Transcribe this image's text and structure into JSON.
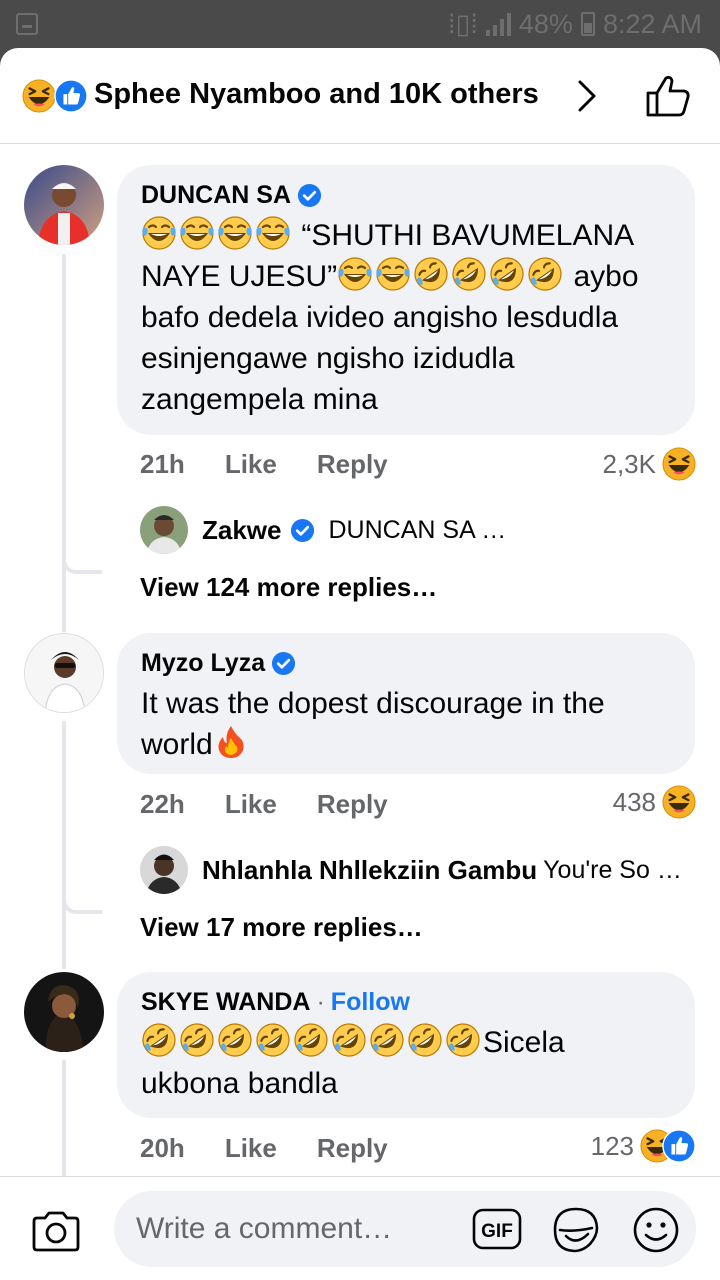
{
  "status_bar": {
    "battery": "48%",
    "time": "8:22 AM"
  },
  "header": {
    "reactors_text": "Sphee Nyamboo and 10K others"
  },
  "comments": [
    {
      "name": "DUNCAN SA",
      "text_prefix": "“SHUTHI BAVUMELANA NAYE UJESU”",
      "text_suffix": " aybo bafo dedela ivideo angisho lesdudla esinjengawe ngisho izidudla zangempela mina",
      "time": "21h",
      "like": "Like",
      "reply": "Reply",
      "reaction_count": "2,3K",
      "reply_preview": {
        "name": "Zakwe",
        "text": "DUNCAN SA  …"
      },
      "view_more": "View 124 more replies…"
    },
    {
      "name": "Myzo Lyza",
      "text": "It was the dopest discourage in the world",
      "time": "22h",
      "like": "Like",
      "reply": "Reply",
      "reaction_count": "438",
      "reply_preview": {
        "name": "Nhlanhla Nhllekziin Gambu",
        "text": "You're So …"
      },
      "view_more": "View 17 more replies…"
    },
    {
      "name": "SKYE WANDA",
      "separator": "·",
      "follow": "Follow",
      "text": "Sicela ukbona bandla",
      "time": "20h",
      "like": "Like",
      "reply": "Reply",
      "reaction_count": "123"
    }
  ],
  "composer": {
    "placeholder": "Write a comment…",
    "gif_label": "GIF"
  },
  "colors": {
    "accent": "#1877f2",
    "bubble": "#f0f2f5",
    "muted": "#65676b",
    "haha": "#f7b125"
  }
}
